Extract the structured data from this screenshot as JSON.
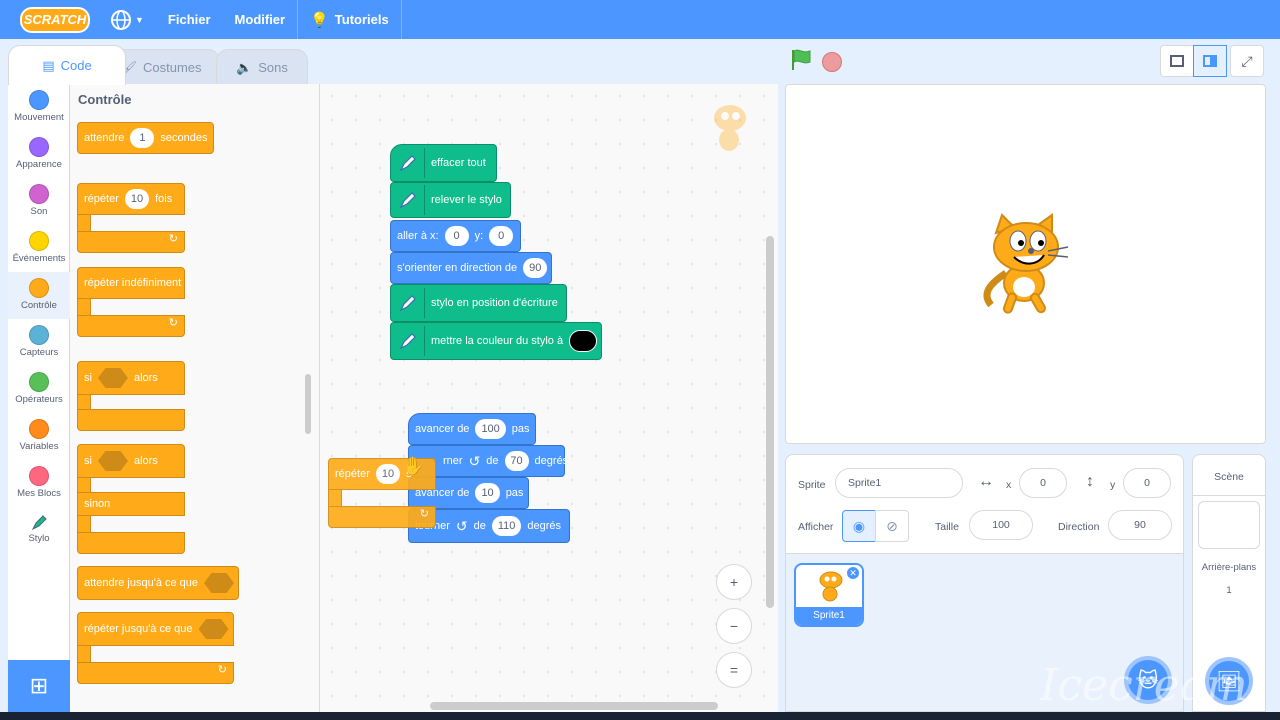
{
  "menubar": {
    "logo": "SCRATCH",
    "file": "Fichier",
    "edit": "Modifier",
    "tutorials": "Tutoriels"
  },
  "tabs": {
    "code": "Code",
    "costumes": "Costumes",
    "sounds": "Sons"
  },
  "categories": [
    {
      "label": "Mouvement",
      "color": "#4c97ff"
    },
    {
      "label": "Apparence",
      "color": "#9966ff"
    },
    {
      "label": "Son",
      "color": "#cf63cf"
    },
    {
      "label": "Événements",
      "color": "#ffd500"
    },
    {
      "label": "Contrôle",
      "color": "#ffab19"
    },
    {
      "label": "Capteurs",
      "color": "#5cb1d6"
    },
    {
      "label": "Opérateurs",
      "color": "#59c059"
    },
    {
      "label": "Variables",
      "color": "#ff8c1a"
    },
    {
      "label": "Mes Blocs",
      "color": "#ff6680"
    },
    {
      "label": "Stylo",
      "color": "#0fbd8c"
    }
  ],
  "palette": {
    "title": "Contrôle",
    "wait": {
      "label": "attendre",
      "value": "1",
      "suffix": "secondes"
    },
    "repeat": {
      "label": "répéter",
      "value": "10",
      "suffix": "fois"
    },
    "forever": "répéter indéfiniment",
    "if_then": {
      "label": "si",
      "suffix": "alors"
    },
    "if_else": {
      "label": "si",
      "suffix": "alors",
      "else": "sinon"
    },
    "wait_until": "attendre jusqu'à ce que",
    "repeat_until": "répéter jusqu'à ce que"
  },
  "script": {
    "clear": "effacer tout",
    "pen_up": "relever le stylo",
    "goto": {
      "label": "aller à x:",
      "x": "0",
      "ylabel": "y:",
      "y": "0"
    },
    "point": {
      "label": "s'orienter en direction de",
      "value": "90"
    },
    "pen_down": "stylo en position d'écriture",
    "set_color": "mettre la couleur du stylo à",
    "move1": {
      "label": "avancer de",
      "value": "100",
      "suffix": "pas"
    },
    "turn1": {
      "label": "rner",
      "prefix": "de",
      "value": "70",
      "suffix": "degrés"
    },
    "move2": {
      "label": "avancer de",
      "value": "10",
      "suffix": "pas"
    },
    "turn2": {
      "label": "tourner",
      "prefix": "de",
      "value": "110",
      "suffix": "degrés"
    },
    "drag_repeat": {
      "label": "répéter",
      "value": "10",
      "suffix": "s"
    }
  },
  "zoom": {
    "in": "+",
    "out": "−",
    "reset": "="
  },
  "sprite": {
    "sprite_label": "Sprite",
    "name": "Sprite1",
    "x_label": "x",
    "x": "0",
    "y_label": "y",
    "y": "0",
    "show_label": "Afficher",
    "size_label": "Taille",
    "size": "100",
    "direction_label": "Direction",
    "direction": "90",
    "thumb_name": "Sprite1"
  },
  "stage_pane": {
    "title": "Scène",
    "backdrops_label": "Arrière-plans",
    "backdrops_count": "1"
  },
  "watermark": "Icecream"
}
